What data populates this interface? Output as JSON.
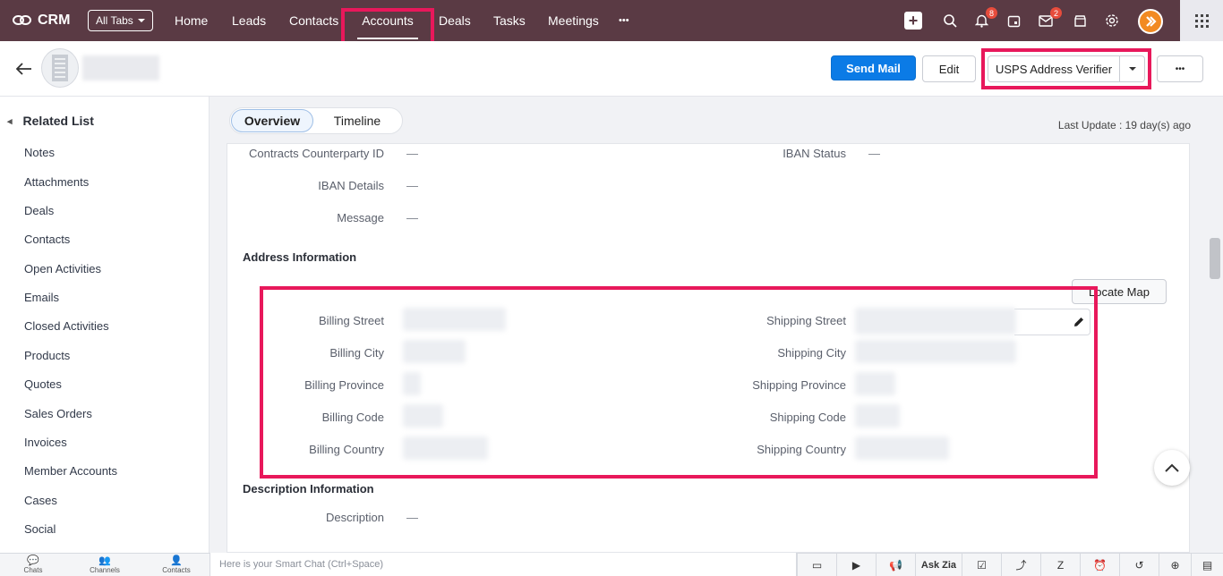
{
  "app": {
    "name": "CRM",
    "all_tabs": "All Tabs"
  },
  "nav": {
    "tabs": [
      "Home",
      "Leads",
      "Contacts",
      "Accounts",
      "Deals",
      "Tasks",
      "Meetings"
    ],
    "more": "•••",
    "active": "Accounts"
  },
  "topicons": {
    "add": "+",
    "notifications_count": "8",
    "mail_count": "2"
  },
  "header": {
    "send_mail": "Send Mail",
    "edit": "Edit",
    "usps": "USPS Address Verifier",
    "more": "•••"
  },
  "sidebar": {
    "title": "Related List",
    "items": [
      "Notes",
      "Attachments",
      "Deals",
      "Contacts",
      "Open Activities",
      "Emails",
      "Closed Activities",
      "Products",
      "Quotes",
      "Sales Orders",
      "Invoices",
      "Member Accounts",
      "Cases",
      "Social"
    ]
  },
  "tabs": {
    "overview": "Overview",
    "timeline": "Timeline"
  },
  "last_update": "Last Update : 19 day(s) ago",
  "fields_top": {
    "contracts_counterparty_id": {
      "label": "Contracts Counterparty ID",
      "value": "—"
    },
    "iban_status": {
      "label": "IBAN Status",
      "value": "—"
    },
    "iban_details": {
      "label": "IBAN Details",
      "value": "—"
    },
    "message": {
      "label": "Message",
      "value": "—"
    }
  },
  "address": {
    "title": "Address Information",
    "locate_map": "Locate Map",
    "billing_labels": [
      "Billing Street",
      "Billing City",
      "Billing Province",
      "Billing Code",
      "Billing Country"
    ],
    "shipping_labels": [
      "Shipping Street",
      "Shipping City",
      "Shipping Province",
      "Shipping Code",
      "Shipping Country"
    ]
  },
  "description": {
    "title": "Description Information",
    "label": "Description",
    "value": "—"
  },
  "bottombar": {
    "chats": "Chats",
    "channels": "Channels",
    "contacts": "Contacts",
    "smart_chat_placeholder": "Here is your Smart Chat (Ctrl+Space)",
    "ask_zia": "Ask Zia"
  },
  "colors": {
    "nav_bg": "#5a3a44",
    "highlight": "#e8185b",
    "primary": "#0b7be6"
  }
}
